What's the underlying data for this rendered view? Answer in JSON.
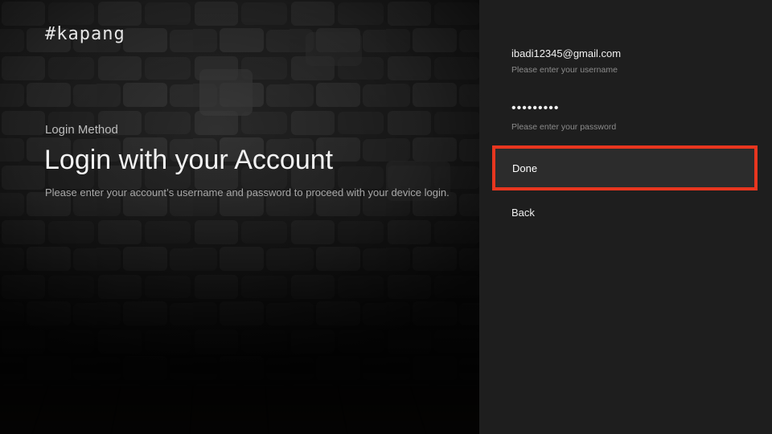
{
  "brand": {
    "logo_text": "#kapang"
  },
  "intro": {
    "subheading": "Login Method",
    "title": "Login with your Account",
    "description": "Please enter your account’s username and password to proceed with your device login."
  },
  "form": {
    "username": {
      "value": "ibadi12345@gmail.com",
      "hint": "Please enter your username"
    },
    "password": {
      "masked_value": "•••••••••",
      "hint": "Please enter your password"
    },
    "done_label": "Done",
    "back_label": "Back"
  },
  "colors": {
    "focus_outline": "#e8361f",
    "panel_background": "#1e1e1e",
    "focused_item_background": "#2c2c2c"
  }
}
